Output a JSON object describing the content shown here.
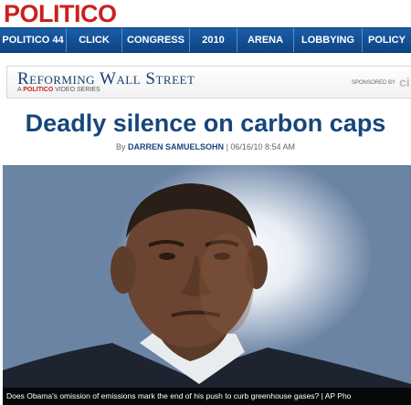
{
  "site": {
    "logo_text": "POLITICO"
  },
  "nav": {
    "items": [
      {
        "label": "POLITICO 44"
      },
      {
        "label": "CLICK"
      },
      {
        "label": "CONGRESS"
      },
      {
        "label": "2010"
      },
      {
        "label": "ARENA"
      },
      {
        "label": "LOBBYING"
      },
      {
        "label": "POLICY"
      }
    ]
  },
  "banner": {
    "title": "Reforming Wall Street",
    "sub_prefix": "A",
    "sub_brand": "POLITICO",
    "sub_suffix": "VIDEO SERIES",
    "sponsored_label": "SPONSORED BY",
    "sponsor_name": "ci"
  },
  "article": {
    "headline": "Deadly silence on carbon caps",
    "byline_prefix": "By",
    "author": "DARREN SAMUELSOHN",
    "date": "06/16/10 8:54 AM"
  },
  "photo": {
    "caption": "Does Obama's omission of emissions mark the end of his push to curb greenhouse gases? | AP Pho"
  },
  "colors": {
    "brand_red": "#cc1f1f",
    "nav_blue": "#0d4483",
    "headline_blue": "#17467b"
  }
}
